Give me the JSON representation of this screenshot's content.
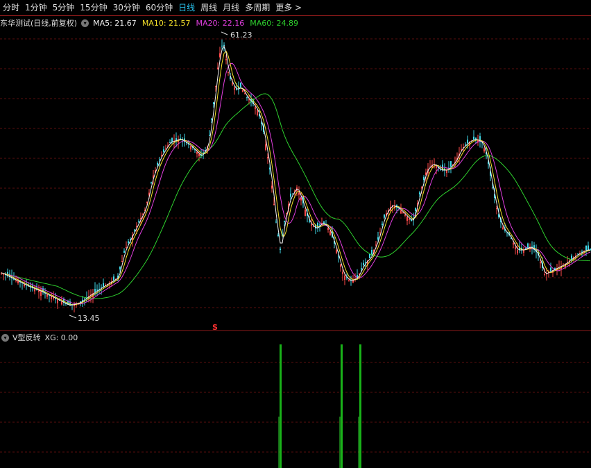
{
  "toolbar": {
    "items": [
      "分时",
      "1分钟",
      "5分钟",
      "15分钟",
      "30分钟",
      "60分钟",
      "日线",
      "周线",
      "月线",
      "多周期",
      "更多 >"
    ],
    "active_index": 6
  },
  "main_legend": {
    "title": "东华测试(日线,前复权)",
    "ma5": "MA5: 21.67",
    "ma10": "MA10: 21.57",
    "ma20": "MA20: 22.16",
    "ma60": "MA60: 24.89"
  },
  "colors": {
    "ma5": "#f0f0f0",
    "ma10": "#f5e12a",
    "ma20": "#e23fe0",
    "ma60": "#2ed02e",
    "up": "#ff4a4a",
    "down": "#3fd8e8",
    "signal": "#19b219",
    "grid": "#5a0e0e"
  },
  "annotations": {
    "high": "61.23",
    "low": "13.45",
    "signal_marker": "S"
  },
  "sub_legend": {
    "name": "V型反转",
    "xg": "XG: 0.00"
  },
  "icons": {
    "dropdown": "chevron-down-icon"
  }
}
